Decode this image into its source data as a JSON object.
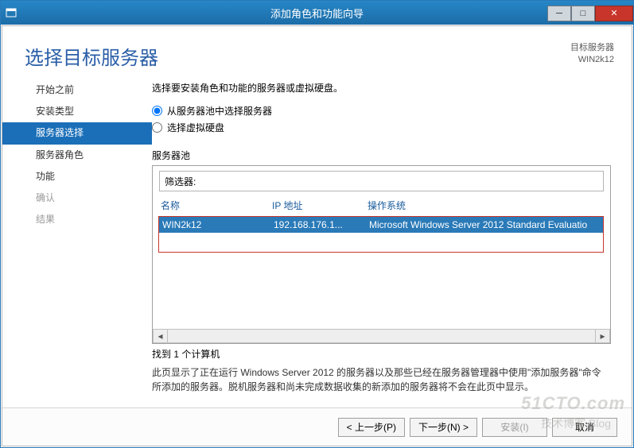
{
  "window": {
    "title": "添加角色和功能向导"
  },
  "header": {
    "page_title": "选择目标服务器",
    "dest_label": "目标服务器",
    "dest_value": "WIN2k12"
  },
  "sidebar": {
    "items": [
      {
        "label": "开始之前"
      },
      {
        "label": "安装类型"
      },
      {
        "label": "服务器选择"
      },
      {
        "label": "服务器角色"
      },
      {
        "label": "功能"
      },
      {
        "label": "确认"
      },
      {
        "label": "结果"
      }
    ]
  },
  "main": {
    "instruction": "选择要安装角色和功能的服务器或虚拟硬盘。",
    "radio_pool": "从服务器池中选择服务器",
    "radio_vhd": "选择虚拟硬盘",
    "pool_label": "服务器池",
    "filter_label": "筛选器:",
    "filter_value": "",
    "columns": {
      "name": "名称",
      "ip": "IP 地址",
      "os": "操作系统"
    },
    "rows": [
      {
        "name": "WIN2k12",
        "ip": "192.168.176.1...",
        "os": "Microsoft Windows Server 2012 Standard Evaluatio"
      }
    ],
    "found": "找到 1 个计算机",
    "note": "此页显示了正在运行 Windows Server 2012 的服务器以及那些已经在服务器管理器中使用\"添加服务器\"命令所添加的服务器。脱机服务器和尚未完成数据收集的新添加的服务器将不会在此页中显示。"
  },
  "footer": {
    "prev": "< 上一步(P)",
    "next": "下一步(N) >",
    "install": "安装(I)",
    "cancel": "取消"
  },
  "watermark": {
    "line1": "51CTO.com",
    "line2": "技术博客  Blog"
  }
}
